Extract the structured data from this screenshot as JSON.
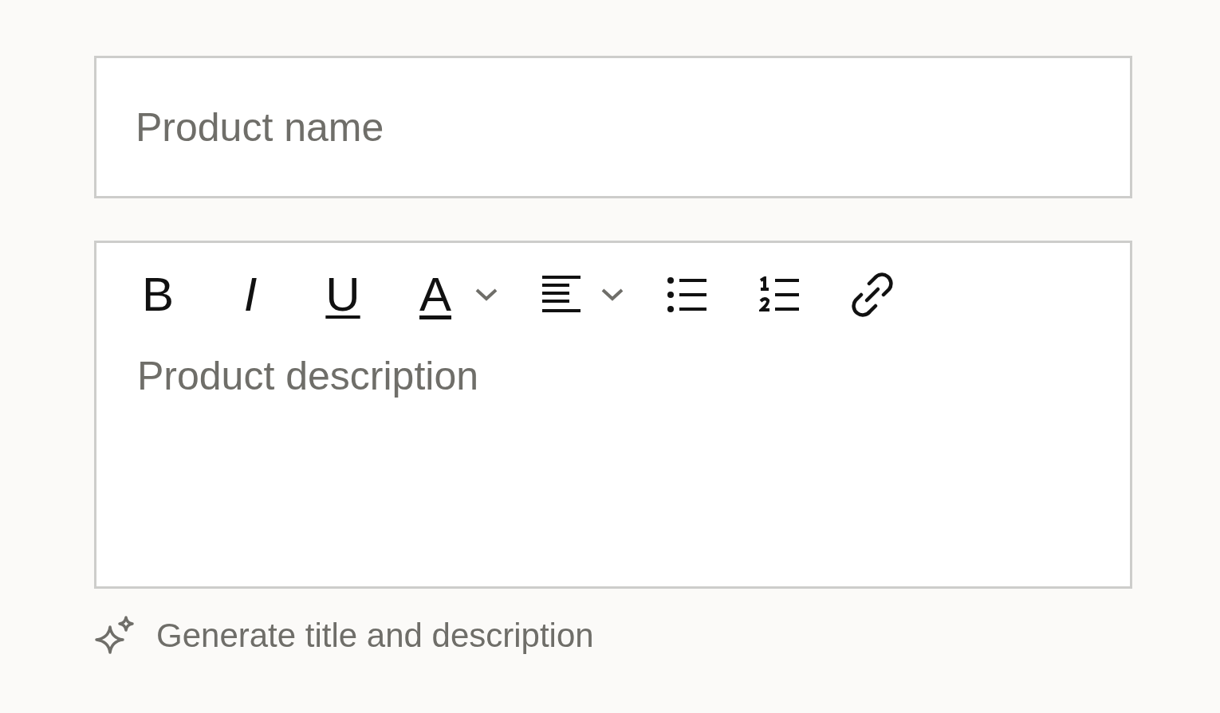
{
  "product_name": {
    "placeholder": "Product name"
  },
  "description_editor": {
    "toolbar": [
      {
        "kind": "bold",
        "label": "B",
        "dropdown": false
      },
      {
        "kind": "italic",
        "label": "I",
        "dropdown": false
      },
      {
        "kind": "underline",
        "label": "U",
        "dropdown": false
      },
      {
        "kind": "textcolor",
        "label": "A",
        "dropdown": true
      },
      {
        "kind": "align",
        "dropdown": true
      },
      {
        "kind": "bullets",
        "dropdown": false
      },
      {
        "kind": "numbered",
        "dropdown": false
      },
      {
        "kind": "link",
        "dropdown": false
      }
    ],
    "placeholder": "Product description"
  },
  "generate_link": {
    "label": "Generate title and description"
  }
}
